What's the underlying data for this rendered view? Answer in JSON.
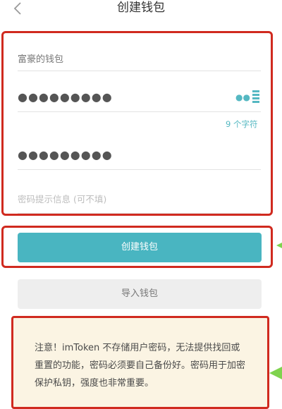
{
  "header": {
    "title": "创建钱包",
    "back_icon": "chevron-left-icon"
  },
  "form": {
    "wallet_name": {
      "value": "富豪的钱包"
    },
    "password": {
      "value": "●●●●●●●●●",
      "strength_indicator": "●●"
    },
    "char_count": "9 个字符",
    "password_confirm": {
      "value": "●●●●●●●●●"
    },
    "hint": {
      "placeholder": "密码提示信息 (可不填)"
    }
  },
  "buttons": {
    "create_label": "创建钱包",
    "import_label": "导入钱包"
  },
  "notice": {
    "text": "注意！imToken 不存储用户密码，无法提供找回或重置的功能，密码必须要自己备份好。密码用于加密保护私钥，强度也非常重要。"
  },
  "colors": {
    "accent": "#49b5c1",
    "highlight_border": "#d02a1f",
    "notice_bg": "#fbf4e3"
  }
}
